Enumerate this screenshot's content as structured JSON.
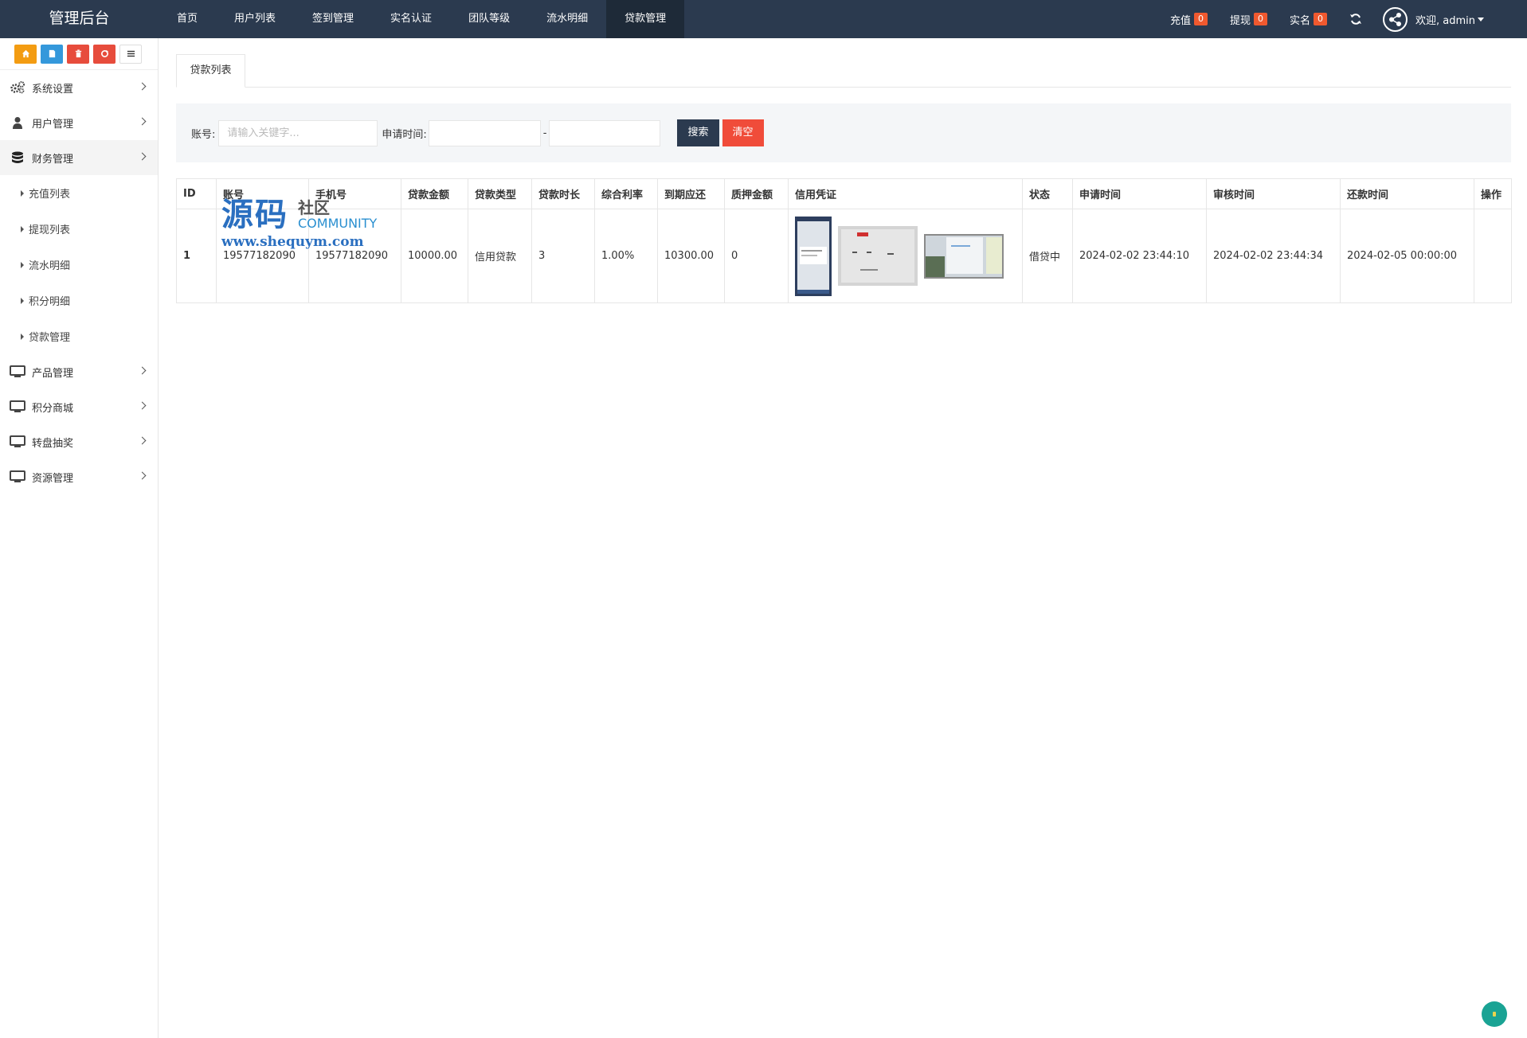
{
  "brand": "管理后台",
  "topnav": [
    "首页",
    "用户列表",
    "签到管理",
    "实名认证",
    "团队等级",
    "流水明细",
    "贷款管理"
  ],
  "topright": {
    "recharge_label": "充值",
    "recharge_count": "0",
    "withdraw_label": "提现",
    "withdraw_count": "0",
    "realname_label": "实名",
    "realname_count": "0",
    "welcome": "欢迎, admin"
  },
  "sidebar": {
    "menu_top": [
      {
        "label": "系统设置",
        "icon": "gears-icon"
      },
      {
        "label": "用户管理",
        "icon": "user-icon"
      },
      {
        "label": "财务管理",
        "icon": "database-icon"
      }
    ],
    "sub_items": [
      "充值列表",
      "提现列表",
      "流水明细",
      "积分明细",
      "贷款管理"
    ],
    "menu_bottom": [
      {
        "label": "产品管理",
        "icon": "monitor-icon"
      },
      {
        "label": "积分商城",
        "icon": "monitor-icon"
      },
      {
        "label": "转盘抽奖",
        "icon": "monitor-icon"
      },
      {
        "label": "资源管理",
        "icon": "monitor-icon"
      }
    ]
  },
  "tab": "贷款列表",
  "search": {
    "account_label": "账号:",
    "account_placeholder": "请输入关键字...",
    "time_label": "申请时间:",
    "dash": "-",
    "search_button": "搜索",
    "clear_button": "清空"
  },
  "table": {
    "headers": [
      "ID",
      "账号",
      "手机号",
      "贷款金额",
      "贷款类型",
      "贷款时长",
      "综合利率",
      "到期应还",
      "质押金额",
      "信用凭证",
      "状态",
      "申请时间",
      "审核时间",
      "还款时间",
      "操作"
    ],
    "rows": [
      {
        "id": "1",
        "account": "19577182090",
        "phone": "19577182090",
        "amount": "10000.00",
        "type": "信用贷款",
        "duration": "3",
        "rate": "1.00%",
        "due": "10300.00",
        "pledge": "0",
        "status": "借贷中",
        "apply_time": "2024-02-02 23:44:10",
        "review_time": "2024-02-02 23:44:34",
        "repay_time": "2024-02-05 00:00:00",
        "op": ""
      }
    ]
  },
  "watermark": {
    "big": "源码",
    "small1": "社区",
    "small2": "COMMUNITY",
    "url": "www.shequym.com"
  },
  "colors": {
    "topbar": "#2b3a4f",
    "accent_red": "#f04c3a",
    "badge": "#f0592f",
    "orange": "#f39c12",
    "blue": "#3498db"
  }
}
